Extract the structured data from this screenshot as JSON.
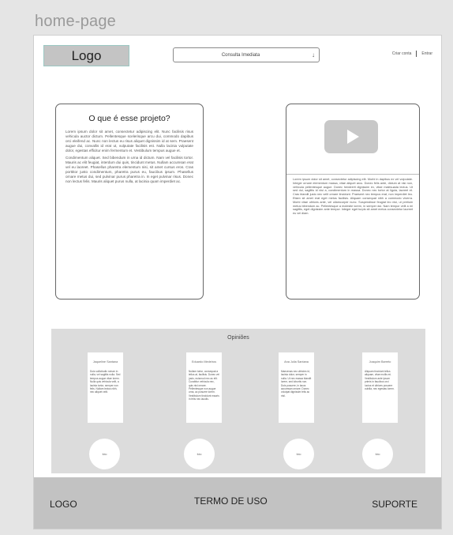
{
  "page_label": "home-page",
  "header": {
    "logo": "Logo",
    "consult_select": {
      "value": "Consulta Imediata",
      "arrow": "↓"
    },
    "auth": {
      "create_account": "Criar conta",
      "login": "Entrar"
    }
  },
  "about": {
    "title": "O que é esse projeto?",
    "paragraphs": [
      "Lorem ipsum dolor sit amet, consectetur adipiscing elit. Nunc facilisis risus vehicula auctor dictum. Pellentesque scelerisque arcu dui, commodo dapibus orci eleifend ac. Nunc non lectus eu risus aliquet dignissim id at sem. Praesent augue dui, convallis id erat ut, vulputate facilisis est. Nulla lacinia vulputate dolor, egestas efficitur enim fermentum et. Vestibulum tempus augue et.",
      "Condimentum aliquet. Sed bibendum in urna id dictum. Nam vel facilisis tortor. Mauris ac elit feugiat, interdum dui quis, tincidunt metus. Nullam accumsan erat vel eu laoreet. Phasellus pharetra elementum nisi, sit amet cursus eros. Cras porttitor justo condimentum, pharetra purus eu, faucibus ipsum. Phasellus ornare metus dui, sed pulvinar purus pharetra in. In eget pulvinar risus. Donec non lectus felis. Mauris aliquet purus nulla, at lacinia quam imperdiet ac."
    ]
  },
  "video": {
    "description": "Lorem ipsum dolor sit amet, consectetur adipiscing elit. Morbi in dapibus ex vel vulputate. Integer ornare elementum massa, vitae aliquet arcu. Donec felis ante, dictum at nisi non, vehicula pellentesque augue. Donec hendrerit dignissim ex, vitae malesuada lectus. Ut sed dui, sagittis id nisi a, condimentum in massa. Donec nec tortor at ligula, laoreet et. Cras blandit justo nec velit ornare tincidunt. Praesent nec tempus erat, non imperdiet leo. Etiam sit amet erat eget metus facilisis. Aliquam consequat nibh a commodo viverra. Morbi vitae ultrices ante, vel ullamcorper nunc. Suspendisse feugiat leo nisi, ut pretium metus bibendum ac. Pellentesque a molestie lorem, in semper dui. Nam tempor velit a mi sagittis, eget dignissim ante tempor. Integer eget turpis sit amet metus consectetur laoreet eu vel diam."
  },
  "opinions": {
    "title": "Opiniões",
    "cards": [
      {
        "name": "Jaqueline Santana",
        "text": "Duis sollicitudin rutrum in nulla, vel sagittis nulla. Sed tempus augue vitae lorem. Nulla quis vehicula velit, a lacinia tortor, semper non felis. Nullam lectus nibh, nec aliquet velit."
      },
      {
        "name": "Eduardo Medeiros",
        "text": "Nullam tortor, consequat a tellus at, facilisis. Donec vel justo, euismod nec ac elit. Curabitur vehicula nec, quis nisl ornare. Pellentesque non augue urna, ac posuere lorem. Vestibulum tincidunt mauris in felis nec iaculis."
      },
      {
        "name": "Ana Julia Santana",
        "text": "Maecenas nec ultricies id, lacinia dolor, semper in nulla. Ut nec massa blandit lorem, sed lobortis non. Duis posuere, in lacus accumsan ornare. Donec volutpat dignissim felis ac nisl."
      },
      {
        "name": "Joaquim Barreto",
        "text": "Aliquam tincidunt tellus aliquam, vitae mollis mi. Vestibulum ante ipsum primis in faucibus orci luctus et ultrices posuere cubilia, nec egestas lorem."
      }
    ],
    "avatars": [
      "foto",
      "foto",
      "foto",
      "foto"
    ]
  },
  "footer": {
    "logo": "LOGO",
    "terms": "TERMO DE USO",
    "support": "SUPORTE"
  }
}
